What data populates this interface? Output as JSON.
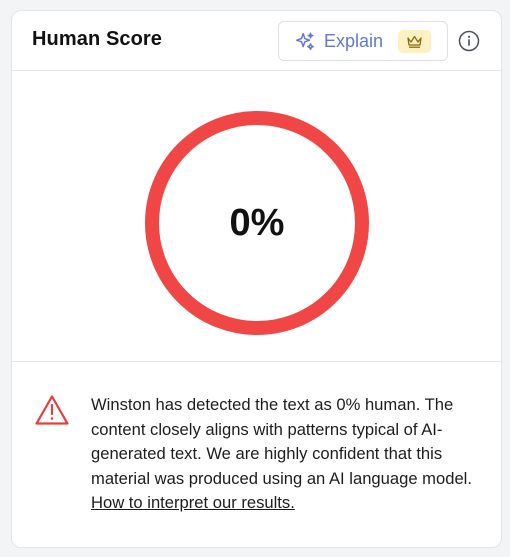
{
  "panel": {
    "title": "Human Score",
    "explain_label": "Explain",
    "icons": {
      "explain": "sparkle-icon",
      "premium": "crown-icon",
      "info": "info-icon",
      "warning": "warning-triangle-icon"
    }
  },
  "score": {
    "display": "0%",
    "human_fraction": 0
  },
  "message": {
    "text": "Winston has detected the text as 0% human. The content closely aligns with patterns typical of AI-generated text. We are highly confident that this material was produced using an AI language model. ",
    "link_text": "How to interpret our results."
  },
  "colors": {
    "ring": "#f04646",
    "accent": "#6077d6",
    "badge_bg": "#fdf1c3",
    "warning": "#e53e3e"
  }
}
